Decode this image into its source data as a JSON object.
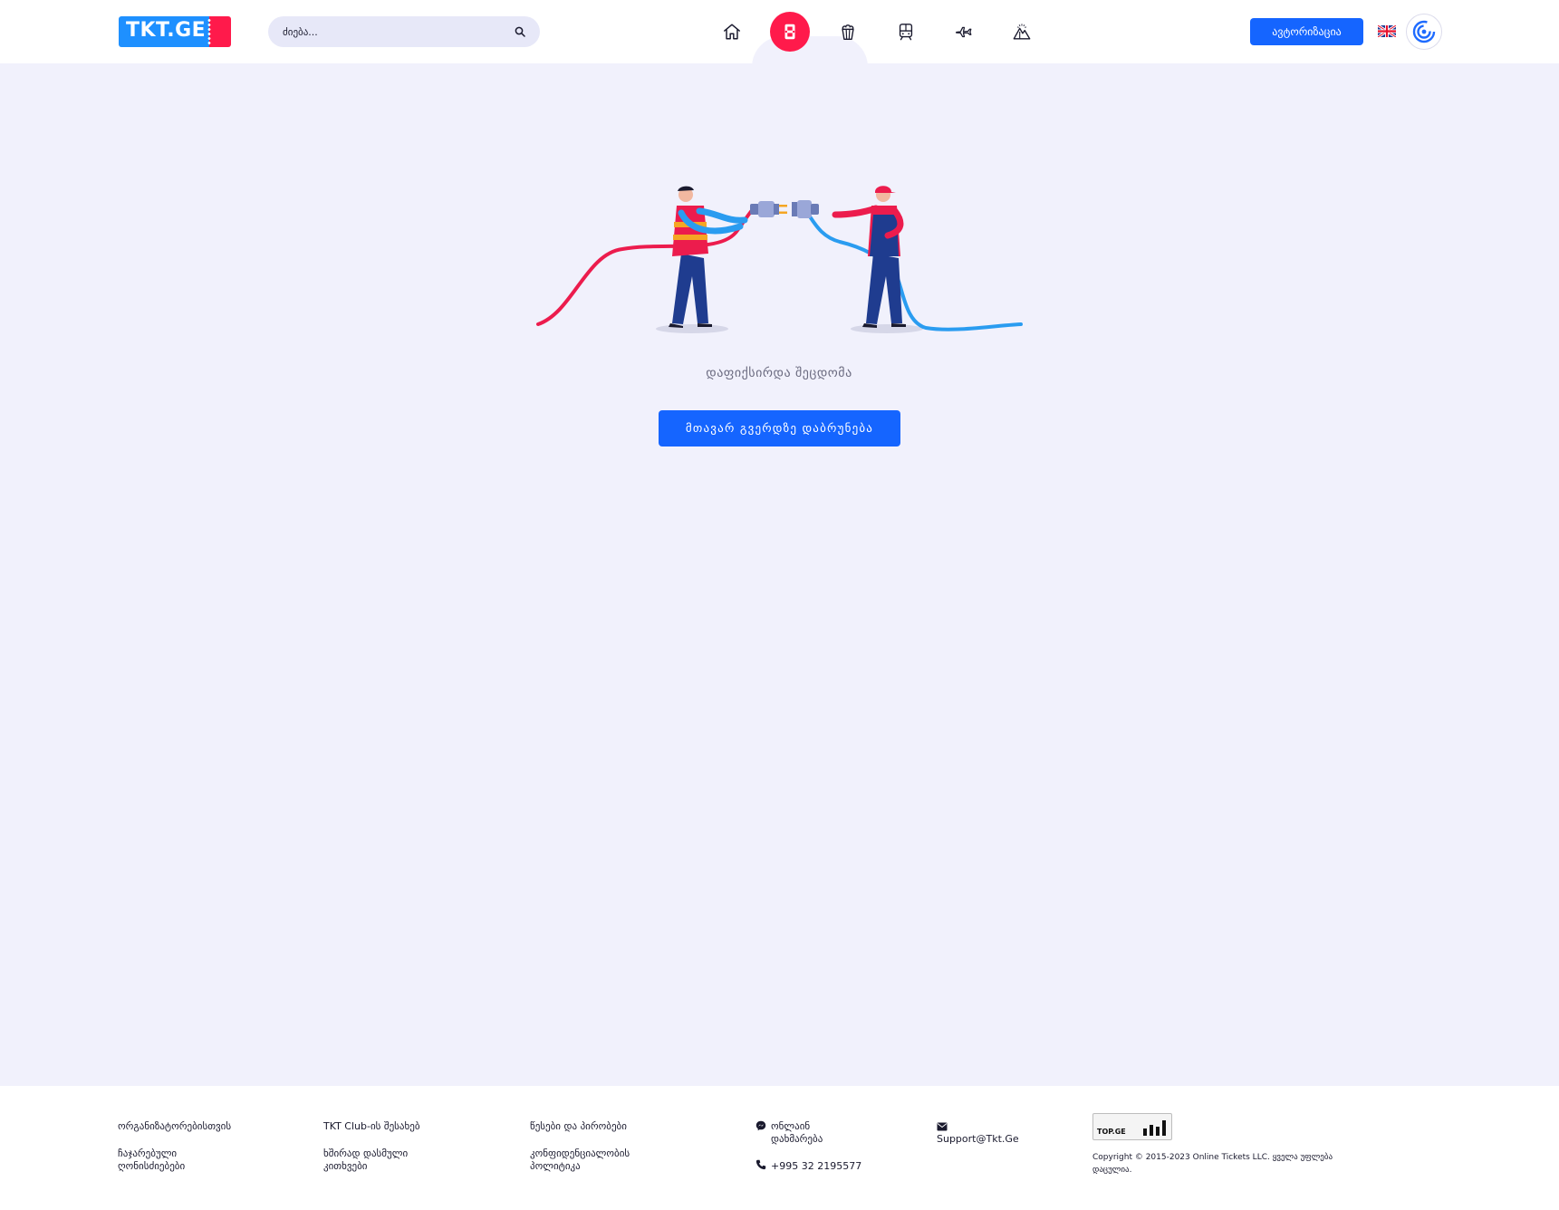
{
  "header": {
    "logo_text": "TKT.GE",
    "search": {
      "placeholder": "ძიება..."
    },
    "nav": [
      {
        "name": "home",
        "icon": "home-icon",
        "active": false
      },
      {
        "name": "tickets",
        "icon": "film-icon",
        "active": true
      },
      {
        "name": "popcorn",
        "icon": "popcorn-icon",
        "active": false
      },
      {
        "name": "train",
        "icon": "train-icon",
        "active": false
      },
      {
        "name": "flight",
        "icon": "plane-icon",
        "active": false
      },
      {
        "name": "tours",
        "icon": "mountain-icon",
        "active": false
      }
    ],
    "auth_label": "ავტორიზაცია",
    "language_flag": "uk-flag-icon",
    "profile_icon": "spiral-icon"
  },
  "main": {
    "illustration": "plug-connection-illustration",
    "error_message": "დაფიქსირდა შეცდომა",
    "home_button_label": "მთავარ გვერდზე დაბრუნება"
  },
  "footer": {
    "col1": [
      "ორგანიზატორებისთვის",
      "ჩაჯარებული ღონისძიებები"
    ],
    "col2": [
      "TKT Club-ის შესახებ",
      "ხშირად დასმული კითხვები"
    ],
    "col3": [
      "წესები და პირობები",
      "კონფიდენციალობის პოლიტიკა"
    ],
    "online_help": "ონლაინ დახმარება",
    "phone": "+995 32 2195577",
    "email": "Support@Tkt.Ge",
    "topge_label": "TOP.GE",
    "copyright": "Copyright © 2015-2023 Online Tickets LLC. ყველა უფლება დაცულია."
  },
  "colors": {
    "primary_blue": "#1565ff",
    "accent_red": "#ff1a4b",
    "page_bg": "#f1f1fc"
  }
}
